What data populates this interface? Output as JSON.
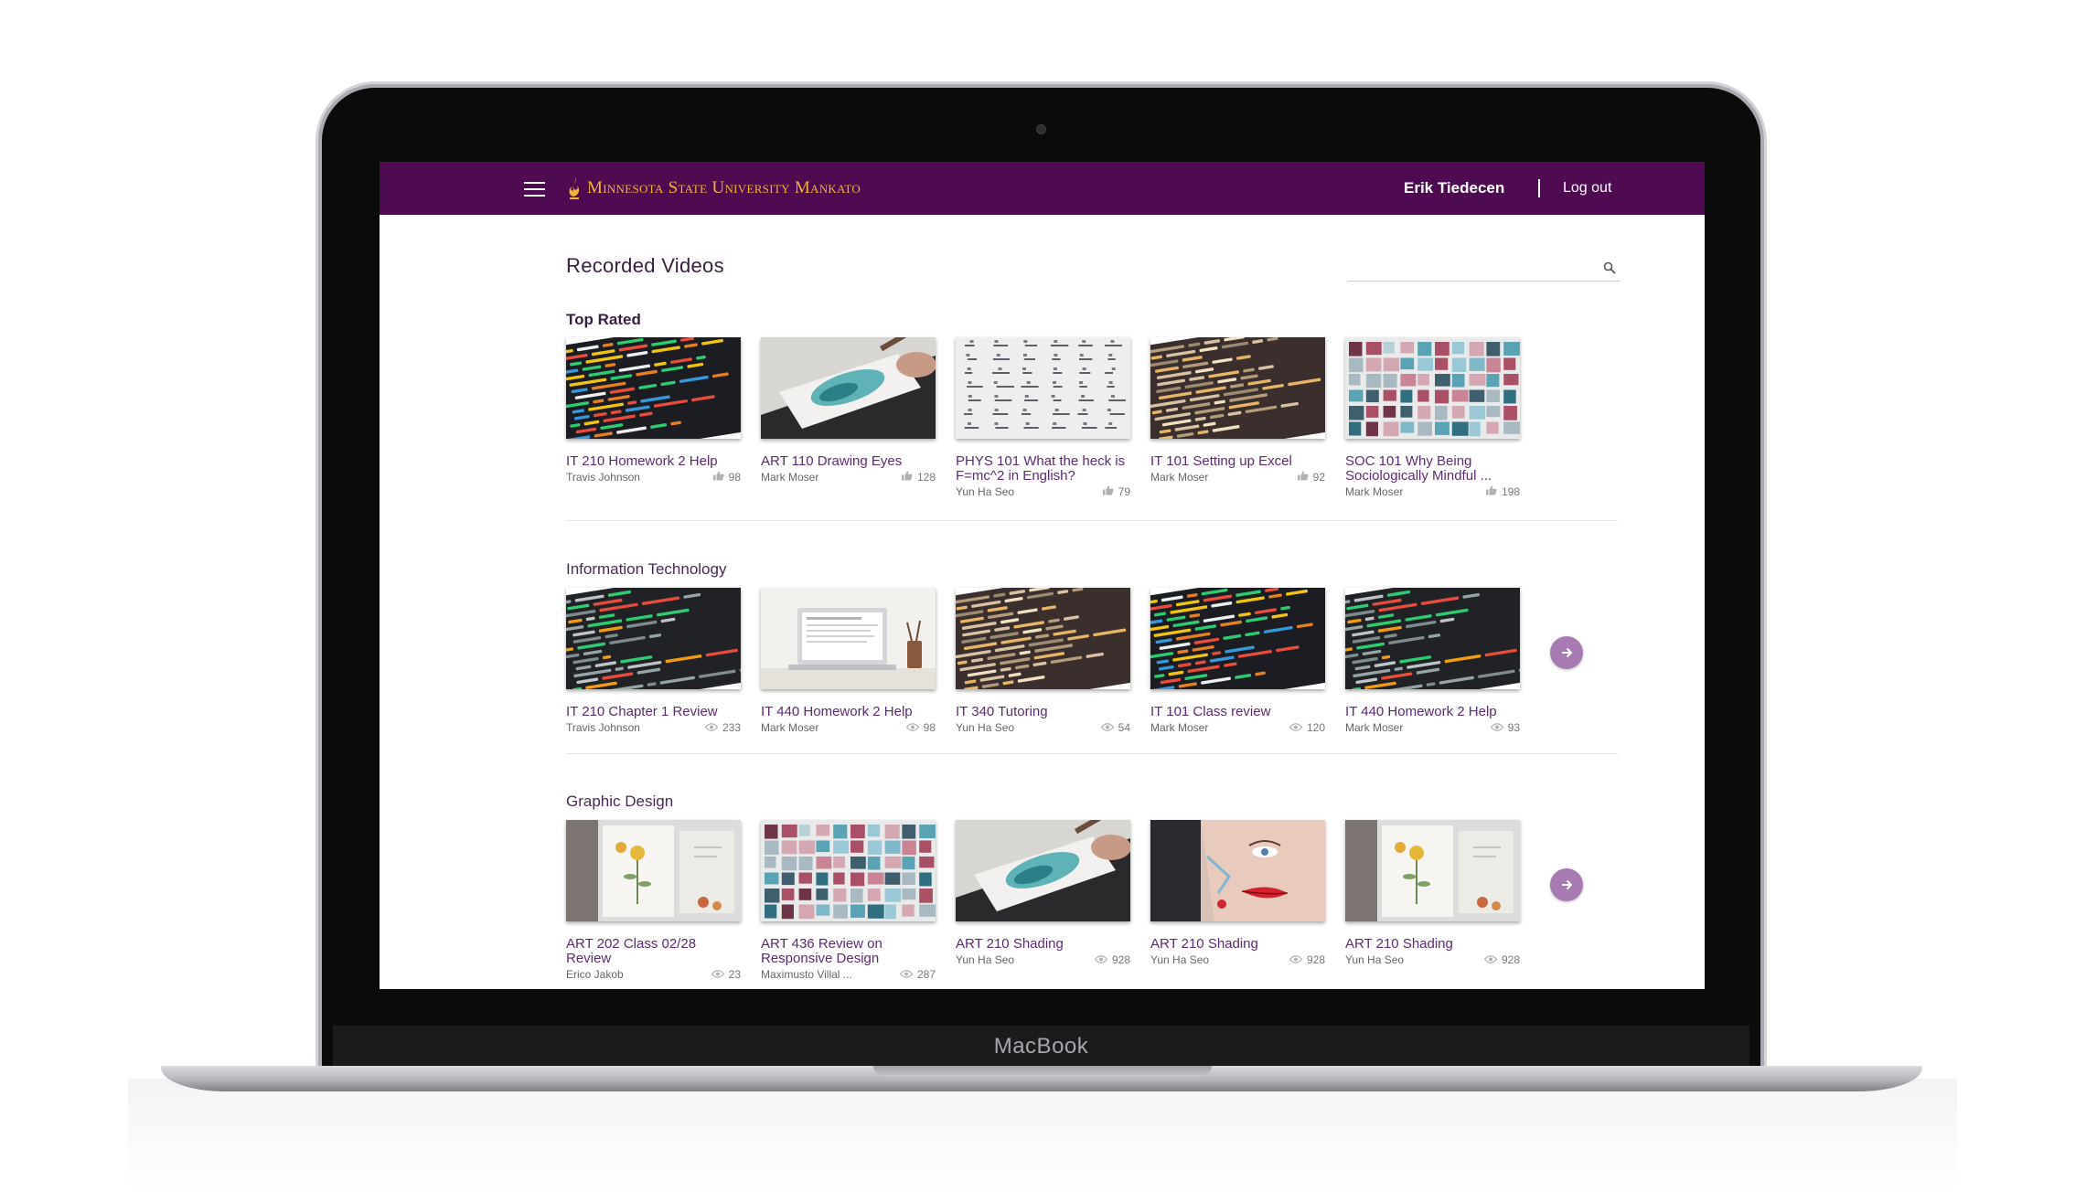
{
  "device": {
    "label": "MacBook"
  },
  "header": {
    "university": "Minnesota State University Mankato",
    "user_name": "Erik Tiedecen",
    "logout_label": "Log out",
    "bar_color": "#4e0b52",
    "logo_color": "#f3b335"
  },
  "page": {
    "title": "Recorded Videos",
    "search": {
      "value": "",
      "placeholder": ""
    }
  },
  "sections": [
    {
      "title": "Top Rated",
      "meta_icon": "thumbs-up-icon",
      "videos": [
        {
          "title": "IT 210 Homework 2 Help",
          "author": "Travis Johnson",
          "count": "98",
          "thumb": "code-dark"
        },
        {
          "title": "ART 110 Drawing Eyes",
          "author": "Mark Moser",
          "count": "128",
          "thumb": "watercolor"
        },
        {
          "title": "PHYS 101 What the heck is F=mc^2 in English?",
          "author": "Yun Ha Seo",
          "count": "79",
          "thumb": "formulas"
        },
        {
          "title": "IT 101 Setting up Excel",
          "author": "Mark Moser",
          "count": "92",
          "thumb": "code-warm"
        },
        {
          "title": "SOC 101 Why Being Sociologically Mindful ...",
          "author": "Mark Moser",
          "count": "198",
          "thumb": "swatches"
        }
      ]
    },
    {
      "title": "Information Technology",
      "meta_icon": "eye-icon",
      "videos": [
        {
          "title": "IT 210 Chapter 1 Review",
          "author": "Travis Johnson",
          "count": "233",
          "thumb": "code-blur"
        },
        {
          "title": "IT 440 Homework 2 Help",
          "author": "Mark Moser",
          "count": "98",
          "thumb": "laptop"
        },
        {
          "title": "IT 340 Tutoring",
          "author": "Yun Ha Seo",
          "count": "54",
          "thumb": "code-warm"
        },
        {
          "title": "IT 101 Class review",
          "author": "Mark Moser",
          "count": "120",
          "thumb": "code-dark"
        },
        {
          "title": "IT 440 Homework 2 Help",
          "author": "Mark Moser",
          "count": "93",
          "thumb": "code-blur"
        }
      ]
    },
    {
      "title": "Graphic Design",
      "meta_icon": "eye-icon",
      "videos": [
        {
          "title": "ART 202 Class 02/28 Review",
          "author": "Erico Jakob",
          "count": "23",
          "thumb": "botanical"
        },
        {
          "title": "ART 436 Review on Responsive Design",
          "author": "Maximusto Villal ...",
          "count": "287",
          "thumb": "swatches"
        },
        {
          "title": "ART 210 Shading",
          "author": "Yun Ha Seo",
          "count": "928",
          "thumb": "watercolor"
        },
        {
          "title": "ART 210 Shading",
          "author": "Yun Ha Seo",
          "count": "928",
          "thumb": "face"
        },
        {
          "title": "ART 210 Shading",
          "author": "Yun Ha Seo",
          "count": "928",
          "thumb": "botanical"
        }
      ]
    }
  ],
  "accent_color": "#a77ab2"
}
